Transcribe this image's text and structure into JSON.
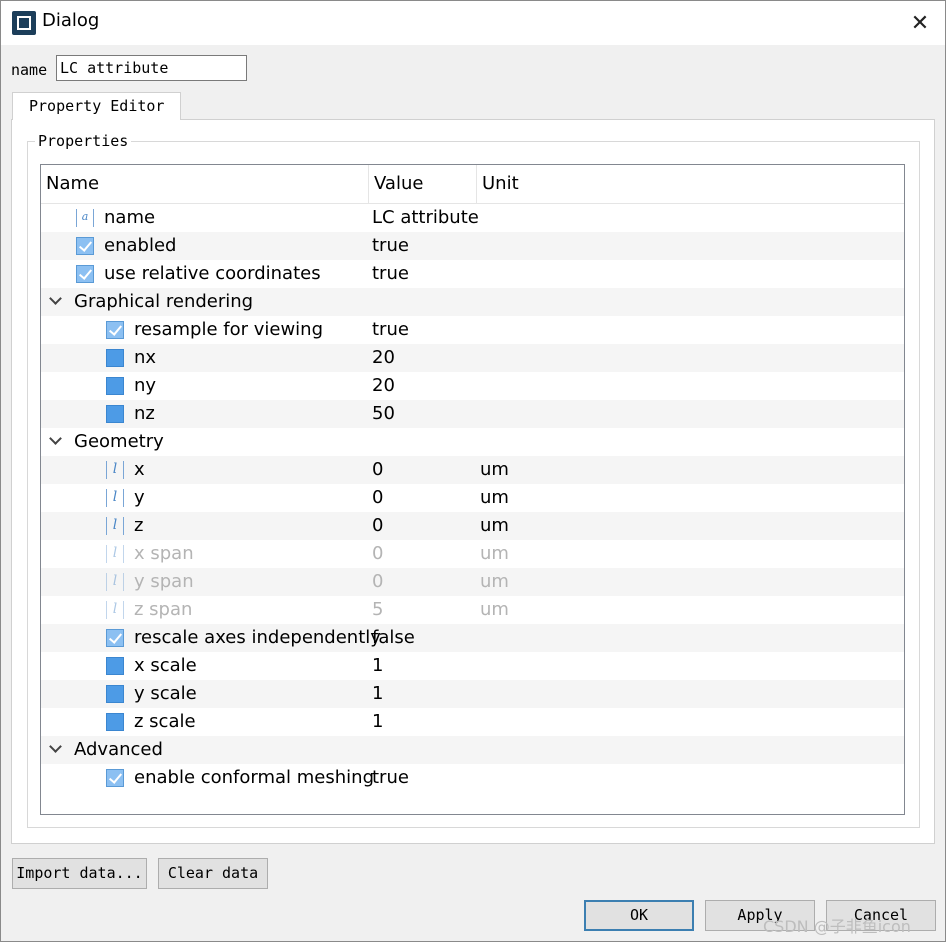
{
  "window": {
    "title": "Dialog"
  },
  "name_field": {
    "label": "name",
    "value": "LC attribute"
  },
  "tabs": [
    {
      "label": "Property Editor"
    }
  ],
  "group": {
    "title": "Properties"
  },
  "tree": {
    "columns": [
      "Name",
      "Value",
      "Unit"
    ],
    "rows": [
      {
        "name": "name",
        "value": "LC attribute",
        "unit": "",
        "icon": "string-icon",
        "level": 1,
        "disabled": false
      },
      {
        "name": "enabled",
        "value": "true",
        "unit": "",
        "icon": "checkbox-icon",
        "level": 1,
        "disabled": false
      },
      {
        "name": "use relative coordinates",
        "value": "true",
        "unit": "",
        "icon": "checkbox-icon",
        "level": 1,
        "disabled": false
      },
      {
        "name": "Graphical rendering",
        "value": "",
        "unit": "",
        "icon": "chevron-down-icon",
        "level": 0,
        "disabled": false
      },
      {
        "name": "resample for viewing",
        "value": "true",
        "unit": "",
        "icon": "checkbox-icon",
        "level": 2,
        "disabled": false
      },
      {
        "name": "nx",
        "value": "20",
        "unit": "",
        "icon": "number-icon",
        "level": 2,
        "disabled": false
      },
      {
        "name": "ny",
        "value": "20",
        "unit": "",
        "icon": "number-icon",
        "level": 2,
        "disabled": false
      },
      {
        "name": "nz",
        "value": "50",
        "unit": "",
        "icon": "number-icon",
        "level": 2,
        "disabled": false
      },
      {
        "name": "Geometry",
        "value": "",
        "unit": "",
        "icon": "chevron-down-icon",
        "level": 0,
        "disabled": false
      },
      {
        "name": "x",
        "value": "0",
        "unit": "um",
        "icon": "length-icon",
        "level": 2,
        "disabled": false
      },
      {
        "name": "y",
        "value": "0",
        "unit": "um",
        "icon": "length-icon",
        "level": 2,
        "disabled": false
      },
      {
        "name": "z",
        "value": "0",
        "unit": "um",
        "icon": "length-icon",
        "level": 2,
        "disabled": false
      },
      {
        "name": "x span",
        "value": "0",
        "unit": "um",
        "icon": "length-icon",
        "level": 2,
        "disabled": true
      },
      {
        "name": "y span",
        "value": "0",
        "unit": "um",
        "icon": "length-icon",
        "level": 2,
        "disabled": true
      },
      {
        "name": "z span",
        "value": "5",
        "unit": "um",
        "icon": "length-icon",
        "level": 2,
        "disabled": true
      },
      {
        "name": "rescale axes independently",
        "value": "false",
        "unit": "",
        "icon": "checkbox-icon",
        "level": 2,
        "disabled": false
      },
      {
        "name": "x scale",
        "value": "1",
        "unit": "",
        "icon": "number-icon",
        "level": 2,
        "disabled": false
      },
      {
        "name": "y scale",
        "value": "1",
        "unit": "",
        "icon": "number-icon",
        "level": 2,
        "disabled": false
      },
      {
        "name": "z scale",
        "value": "1",
        "unit": "",
        "icon": "number-icon",
        "level": 2,
        "disabled": false
      },
      {
        "name": "Advanced",
        "value": "",
        "unit": "",
        "icon": "chevron-down-icon",
        "level": 0,
        "disabled": false
      },
      {
        "name": "enable conformal meshing",
        "value": "true",
        "unit": "",
        "icon": "checkbox-icon",
        "level": 2,
        "disabled": false
      }
    ]
  },
  "buttons": {
    "import": "Import data...",
    "clear": "Clear data",
    "ok": "OK",
    "apply": "Apply",
    "cancel": "Cancel"
  },
  "watermark": "CSDN @子非鱼icon",
  "colors": {
    "accent": "#3c7fb1",
    "icon_blue": "#4d9be6",
    "disabled_text": "#b4b4b4"
  }
}
